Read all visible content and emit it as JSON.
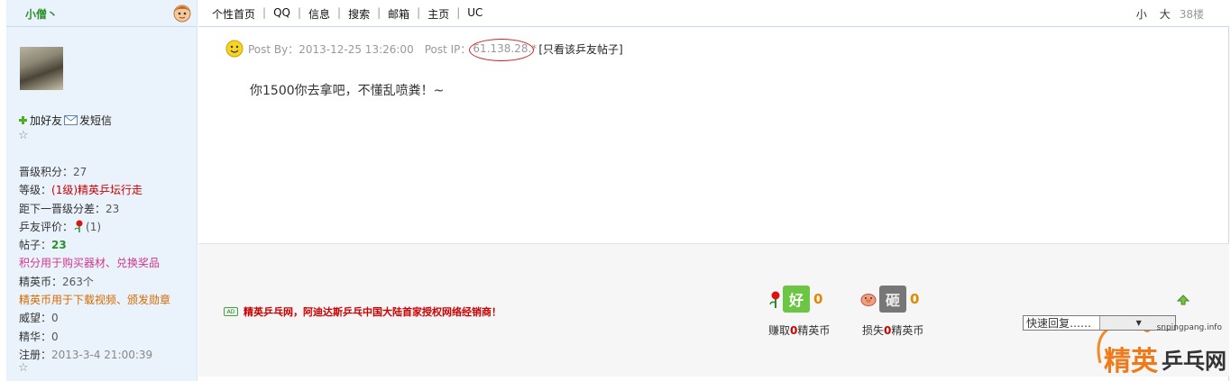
{
  "sidebar": {
    "username": "小僧丶",
    "add_friend": "加好友",
    "send_message": "发短信",
    "stats": {
      "points_label": "晋级积分：",
      "points_value": "27",
      "level_label": "等级：",
      "level_value": "(1级)精英乒坛行走",
      "next_label": "距下一晋级分差：",
      "next_value": "23",
      "rating_label": "乒友评价：",
      "rating_value": "(1)",
      "posts_label": "帖子：",
      "posts_value": "23",
      "points_note": "积分用于购买器材、兑换奖品",
      "coins_label": "精英币：",
      "coins_value": "263个",
      "coins_note": "精英币用于下载视频、颁发勋章",
      "prestige_label": "威望：",
      "prestige_value": "0",
      "essence_label": "精华：",
      "essence_value": "0",
      "register_label": "注册：",
      "register_value": "2013-3-4 21:00:39"
    }
  },
  "nav": {
    "items": [
      "个性首页",
      "QQ",
      "信息",
      "搜索",
      "邮箱",
      "主页",
      "UC"
    ],
    "font_small": "小",
    "font_large": "大",
    "floor": "38楼"
  },
  "post": {
    "meta_by": "Post By：2013-12-25 13:26:00",
    "meta_ip_label": "Post IP：",
    "meta_ip": "61.138.28.*",
    "only_author": "[只看该乒友帖子]",
    "content": "你1500你去拿吧，不懂乱喷粪！~"
  },
  "footer": {
    "ad_icon": "AD",
    "ad_text": "精英乒乓网，阿迪达斯乒乓中国大陆首家授权网络经销商！",
    "good": {
      "label": "好",
      "count": "0",
      "caption_pre": "赚取",
      "caption_num": "0",
      "caption_post": "精英币"
    },
    "bad": {
      "label": "砸",
      "count": "0",
      "caption_pre": "损失",
      "caption_num": "0",
      "caption_post": "精英币"
    },
    "quick_reply": "快速回复……",
    "logo_site": "snpingpang.info",
    "logo_text_1": "精英",
    "logo_text_2": "乒乓网"
  }
}
